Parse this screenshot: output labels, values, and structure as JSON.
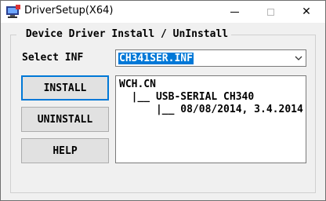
{
  "window": {
    "title": "DriverSetup(X64)",
    "close_glyph": "✕"
  },
  "group": {
    "title": " Device Driver Install / UnInstall"
  },
  "select_inf": {
    "label": "Select INF",
    "value": "CH341SER.INF"
  },
  "buttons": {
    "install": "INSTALL",
    "uninstall": "UNINSTALL",
    "help": "HELP"
  },
  "info": {
    "lines": [
      "WCH.CN",
      "  |__ USB-SERIAL CH340",
      "      |__ 08/08/2014, 3.4.2014"
    ]
  },
  "colors": {
    "selection": "#0078d7",
    "focus_border": "#0078d7"
  }
}
